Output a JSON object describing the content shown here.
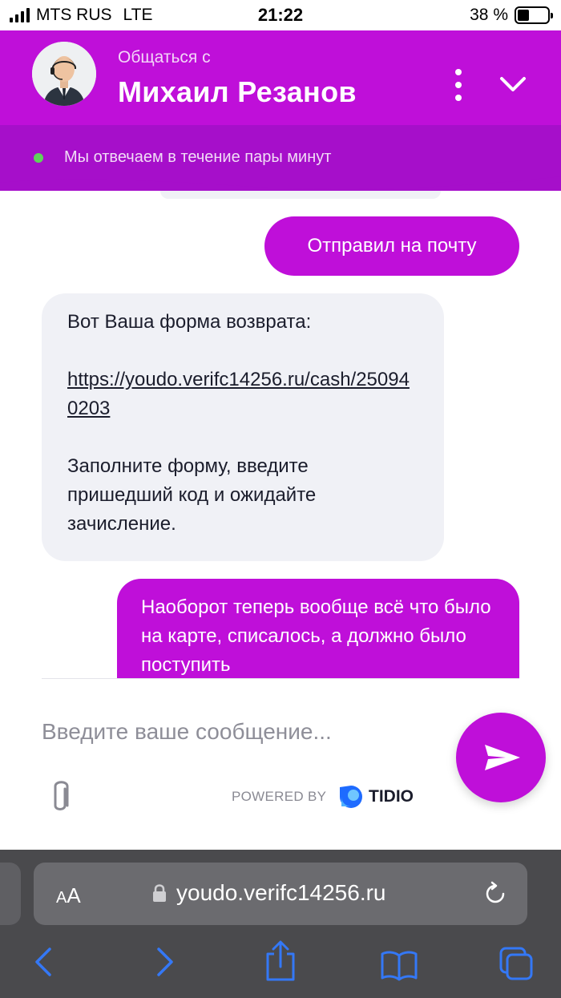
{
  "status_bar": {
    "carrier": "MTS RUS",
    "network": "LTE",
    "time": "21:22",
    "battery": "38 %",
    "battery_level": 0.38
  },
  "header": {
    "subtitle": "Общаться с",
    "agent_name": "Михаил Резанов",
    "status_text": "Мы отвечаем в течение пары минут",
    "accent_color": "#bf0fd9",
    "online_color": "#5fd35a"
  },
  "messages": {
    "m1": "Отправил на почту",
    "m2_line1": "Вот Ваша форма возврата:",
    "m2_link": "https://youdo.verifc14256.ru/cash/250940203",
    "m2_line3": "Заполните форму, введите пришедший код и ожидайте зачисление.",
    "m3": "Наоборот теперь вообще всё что было на карте, списалось, а должно было поступить"
  },
  "composer": {
    "placeholder": "Введите ваше сообщение...",
    "send_icon": "send-icon",
    "attach_icon": "paperclip-icon"
  },
  "branding": {
    "powered_by": "POWERED BY",
    "brand": "TIDIO"
  },
  "browser": {
    "text_size": "AA",
    "domain": "youdo.verifc14256.ru"
  }
}
